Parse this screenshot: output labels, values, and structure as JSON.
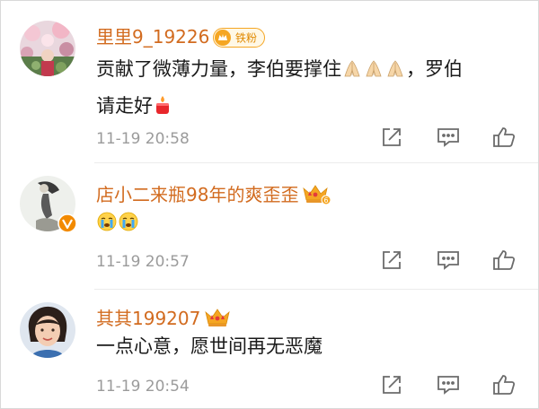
{
  "comments": [
    {
      "username": "里里9_19226",
      "badge": "铁粉",
      "text_main": "贡献了微薄力量，李伯要撑住",
      "text_tail": "，罗伯",
      "text_line2": "请走好",
      "time": "11-19 20:58"
    },
    {
      "username": "店小二来瓶98年的爽歪歪",
      "badge_level": "6",
      "time": "11-19 20:57"
    },
    {
      "username": "其其199207",
      "text": "一点心意，愿世间再无恶魔",
      "time": "11-19 20:54"
    }
  ],
  "icons": {
    "share": "share-icon",
    "comment": "comment-icon",
    "like": "like-icon",
    "pray": "praying-hands-emoji",
    "candle": "candle-emoji",
    "crying": "crying-face-emoji",
    "verified": "verified-v-icon",
    "vip": "vip-crown-icon"
  },
  "colors": {
    "username": "#d26b1f",
    "meta": "#9b9b9b",
    "badge": "#f5a623",
    "verified": "#f28a00"
  }
}
